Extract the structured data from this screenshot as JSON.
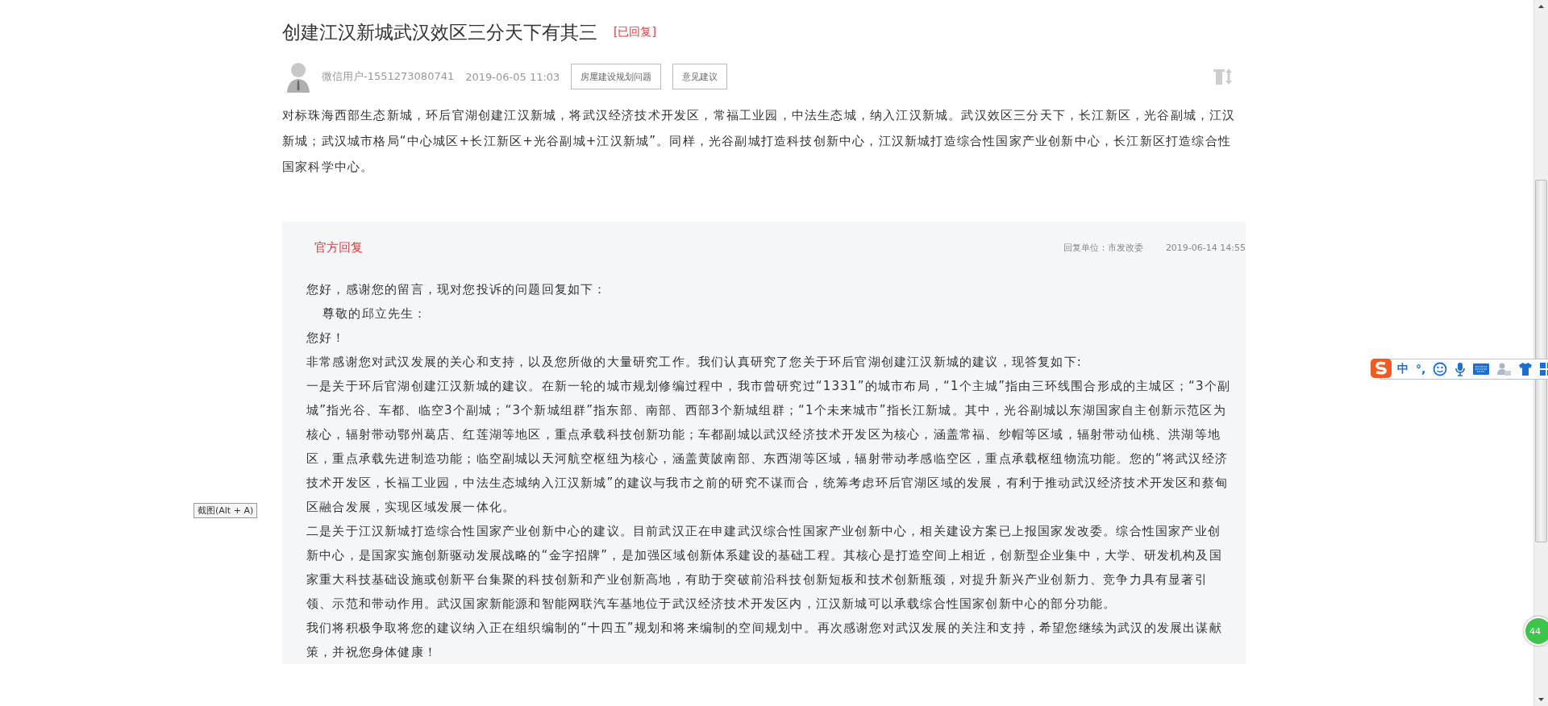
{
  "post": {
    "title": "创建江汉新城武汉效区三分天下有其三",
    "status": "[已回复]",
    "author": "微信用户-1551273080741",
    "date": "2019-06-05 11:03",
    "tags": [
      "房屋建设规划问题",
      "意见建议"
    ],
    "body": "对标珠海西部生态新城，环后官湖创建江汉新城，将武汉经济技术开发区，常福工业园，中法生态城，纳入江汉新城。武汉效区三分天下，长江新区，光谷副城，江汉新城；武汉城市格局“中心城区+长江新区+光谷副城+江汉新城”。同样，光谷副城打造科技创新中心，江汉新城打造综合性国家产业创新中心，长江新区打造综合性国家科学中心。"
  },
  "reply": {
    "label": "官方回复",
    "unit": "回复单位：市发改委",
    "date": "2019-06-14 14:55",
    "paragraphs": [
      {
        "kind": "plain",
        "text": "您好，感谢您的留言，现对您投诉的问题回复如下："
      },
      {
        "kind": "indented",
        "text": "尊敬的邱立先生："
      },
      {
        "kind": "plain",
        "text": "您好！"
      },
      {
        "kind": "plain",
        "text": "非常感谢您对武汉发展的关心和支持，以及您所做的大量研究工作。我们认真研究了您关于环后官湖创建江汉新城的建议，现答复如下:"
      },
      {
        "kind": "plain",
        "text": "一是关于环后官湖创建江汉新城的建议。在新一轮的城市规划修编过程中，我市曾研究过“1331”的城市布局，“1个主城”指由三环线围合形成的主城区；“3个副城”指光谷、车都、临空3个副城；“3个新城组群”指东部、南部、西部3个新城组群；“1个未来城市”指长江新城。其中，光谷副城以东湖国家自主创新示范区为核心，辐射带动鄂州葛店、红莲湖等地区，重点承载科技创新功能；车都副城以武汉经济技术开发区为核心，涵盖常福、纱帽等区域，辐射带动仙桃、洪湖等地区，重点承载先进制造功能；临空副城以天河航空枢纽为核心，涵盖黄陂南部、东西湖等区域，辐射带动孝感临空区，重点承载枢纽物流功能。您的“将武汉经济技术开发区，长福工业园，中法生态城纳入江汉新城”的建议与我市之前的研究不谋而合，统筹考虑环后官湖区域的发展，有利于推动武汉经济技术开发区和蔡甸区融合发展，实现区域发展一体化。"
      },
      {
        "kind": "plain",
        "text": "二是关于江汉新城打造综合性国家产业创新中心的建议。目前武汉正在申建武汉综合性国家产业创新中心，相关建设方案已上报国家发改委。综合性国家产业创新中心，是国家实施创新驱动发展战略的“金字招牌”，是加强区域创新体系建设的基础工程。其核心是打造空间上相近，创新型企业集中，大学、研发机构及国家重大科技基础设施或创新平台集聚的科技创新和产业创新高地，有助于突破前沿科技创新短板和技术创新瓶颈，对提升新兴产业创新力、竞争力具有显著引领、示范和带动作用。武汉国家新能源和智能网联汽车基地位于武汉经济技术开发区内，江汉新城可以承载综合性国家创新中心的部分功能。"
      },
      {
        "kind": "plain",
        "text": "我们将积极争取将您的建议纳入正在组织编制的“十四五”规划和将来编制的空间规划中。再次感谢您对武汉发展的关注和支持，希望您继续为武汉的发展出谋献策，并祝您身体健康！"
      }
    ]
  },
  "tooltip": "截图(Alt + A)",
  "ime_toolbar": {
    "items": [
      "中",
      "°,"
    ]
  },
  "floating_badge": "44"
}
